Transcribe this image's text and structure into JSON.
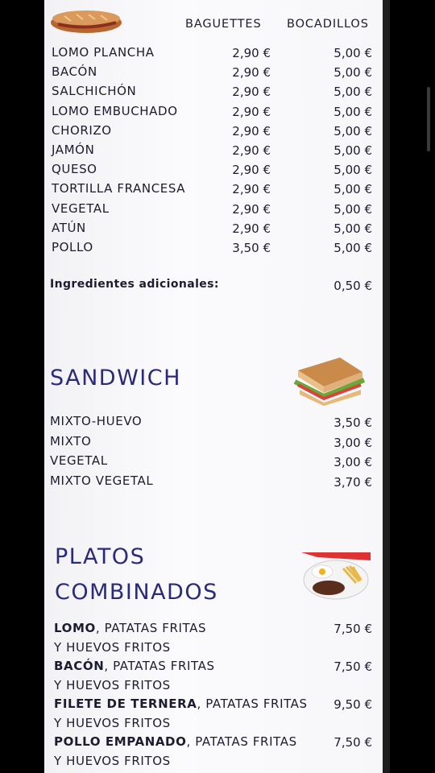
{
  "headers": {
    "baguettes": "BAGUETTES",
    "bocadillos": "BOCADILLOS"
  },
  "bocadillos": [
    {
      "name": "LOMO PLANCHA",
      "baguette": "2,90 €",
      "bocadillo": "5,00 €"
    },
    {
      "name": "BACÓN",
      "baguette": "2,90 €",
      "bocadillo": "5,00 €"
    },
    {
      "name": "SALCHICHÓN",
      "baguette": "2,90 €",
      "bocadillo": "5,00 €"
    },
    {
      "name": "LOMO EMBUCHADO",
      "baguette": "2,90 €",
      "bocadillo": "5,00 €"
    },
    {
      "name": "CHORIZO",
      "baguette": "2,90 €",
      "bocadillo": "5,00 €"
    },
    {
      "name": "JAMÓN",
      "baguette": "2,90 €",
      "bocadillo": "5,00 €"
    },
    {
      "name": "QUESO",
      "baguette": "2,90 €",
      "bocadillo": "5,00 €"
    },
    {
      "name": "TORTILLA FRANCESA",
      "baguette": "2,90 €",
      "bocadillo": "5,00 €"
    },
    {
      "name": "VEGETAL",
      "baguette": "2,90 €",
      "bocadillo": "5,00 €"
    },
    {
      "name": "ATÚN",
      "baguette": "2,90 €",
      "bocadillo": "5,00 €"
    },
    {
      "name": "POLLO",
      "baguette": "3,50 €",
      "bocadillo": "5,00 €"
    }
  ],
  "extras": {
    "label": "Ingredientes adicionales:",
    "price": "0,50 €"
  },
  "sandwich": {
    "title": "SANDWICH",
    "items": [
      {
        "name": "MIXTO-HUEVO",
        "price": "3,50 €"
      },
      {
        "name": "MIXTO",
        "price": "3,00 €"
      },
      {
        "name": "VEGETAL",
        "price": "3,00 €"
      },
      {
        "name": "MIXTO VEGETAL",
        "price": "3,70 €"
      }
    ]
  },
  "platos": {
    "title_line1": "PLATOS",
    "title_line2": "COMBINADOS",
    "items": [
      {
        "bold": "LOMO",
        "rest": ", PATATAS FRITAS",
        "line2": "Y HUEVOS FRITOS",
        "price": "7,50 €"
      },
      {
        "bold": "BACÓN",
        "rest": ", PATATAS FRITAS",
        "line2": "Y HUEVOS FRITOS",
        "price": "7,50 €"
      },
      {
        "bold": "FILETE DE TERNERA",
        "rest": ", PATATAS FRITAS",
        "line2": "Y HUEVOS FRITOS",
        "price": "9,50 €"
      },
      {
        "bold": "POLLO EMPANADO",
        "rest": ", PATATAS FRITAS",
        "line2": "Y HUEVOS FRITOS",
        "price": "7,50 €"
      }
    ]
  }
}
